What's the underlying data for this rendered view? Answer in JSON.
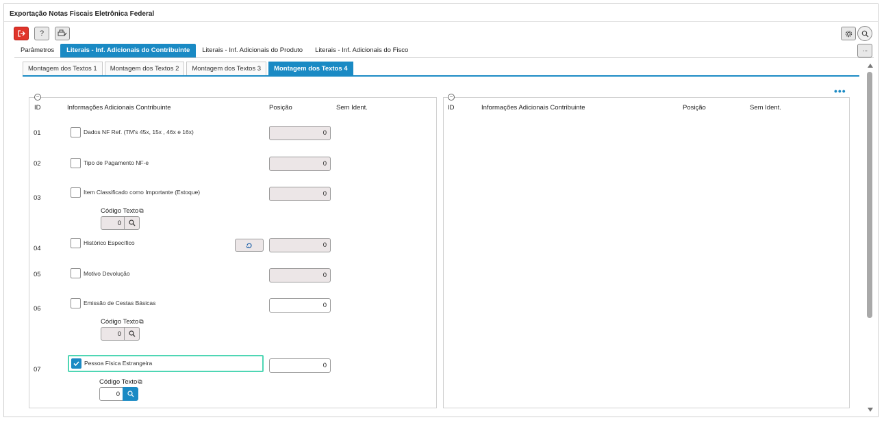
{
  "window": {
    "title": "Exportação Notas Fiscais Eletrônica Federal"
  },
  "toolbar": {
    "exit_icon": "exit-icon",
    "help_label": "?",
    "print_icon": "print-icon",
    "settings_icon": "gear-icon",
    "search_icon": "search-icon",
    "more_label": "···"
  },
  "main_tabs": [
    {
      "label": "Parâmetros"
    },
    {
      "label": "Literais - Inf. Adicionais do Contribuinte",
      "active": true
    },
    {
      "label": "Literais - Inf. Adicionais do Produto"
    },
    {
      "label": "Literais - Inf. Adicionais do Fisco"
    }
  ],
  "sub_tabs": [
    {
      "label": "Montagem dos Textos 1"
    },
    {
      "label": "Montagem dos Textos 2"
    },
    {
      "label": "Montagem dos Textos 3"
    },
    {
      "label": "Montagem dos Textos 4",
      "active": true
    }
  ],
  "more_dots": "•••",
  "left_panel": {
    "collapse": "−",
    "headers": {
      "id": "ID",
      "info": "Informações Adicionais Contribuinte",
      "position": "Posição",
      "no_ident": "Sem Ident."
    },
    "rows": [
      {
        "id": "01",
        "label": "Dados NF Ref. (TM's 45x, 15x , 46x e 16x)",
        "checked": false,
        "position": "0"
      },
      {
        "id": "02",
        "label": "Tipo de Pagamento NF-e",
        "checked": false,
        "position": "0"
      },
      {
        "id": "03",
        "label": "Item Classificado como Importante (Estoque)",
        "checked": false,
        "position": "0",
        "code_label": "Código Texto",
        "code_value": "0"
      },
      {
        "id": "04",
        "label": "Histórico Específico",
        "checked": false,
        "position": "0"
      },
      {
        "id": "05",
        "label": "Motivo Devolução",
        "checked": false,
        "position": "0"
      },
      {
        "id": "06",
        "label": "Emissão de Cestas Básicas",
        "checked": false,
        "position": "0",
        "code_label": "Código Texto",
        "code_value": "0"
      },
      {
        "id": "07",
        "label": "Pessoa Física Estrangeira",
        "checked": true,
        "position": "0",
        "code_label": "Código Texto",
        "code_value": "0"
      }
    ]
  },
  "right_panel": {
    "collapse": "−",
    "headers": {
      "id": "ID",
      "info": "Informações Adicionais Contribuinte",
      "position": "Posição",
      "no_ident": "Sem Ident."
    }
  },
  "colors": {
    "accent": "#1a8ac4",
    "danger": "#e0352b",
    "focus": "#4fd6b4",
    "readonly_bg": "#ece6e7"
  }
}
